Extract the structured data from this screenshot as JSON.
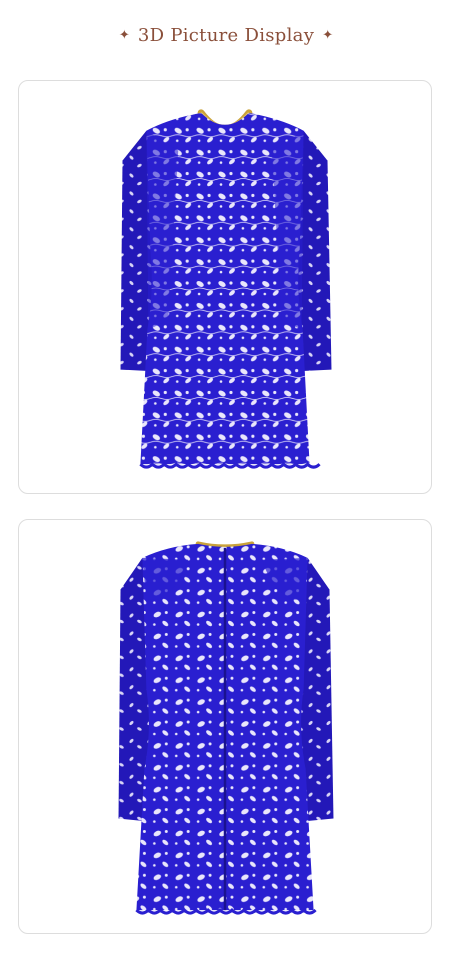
{
  "heading": {
    "text": "3D Picture Display",
    "left_icon": "sparkle-star-icon",
    "right_icon": "sparkle-star-icon",
    "color": "#8a4f3a"
  },
  "images": [
    {
      "name": "dress-front-view",
      "dress_color": "#2a1fd0",
      "lace_color": "#e9e6fb"
    },
    {
      "name": "dress-back-view",
      "dress_color": "#2a1fd0",
      "lace_color": "#e9e6fb"
    }
  ]
}
